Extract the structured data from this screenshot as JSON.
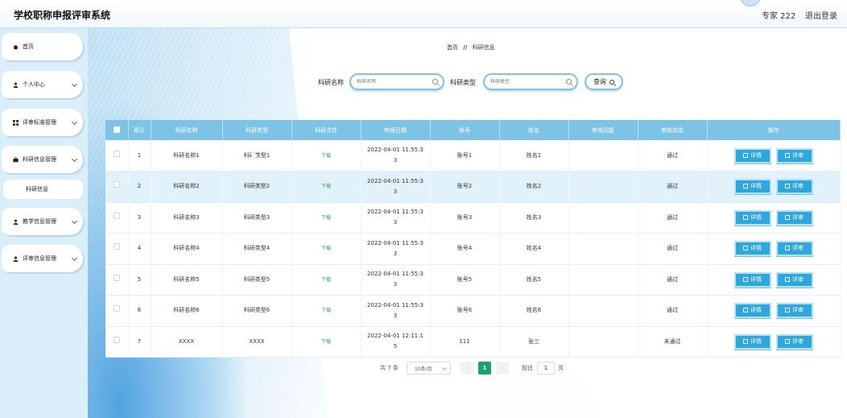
{
  "header": {
    "app_title": "学校职称申报评审系统",
    "user": "专家 222",
    "logout": "退出登录"
  },
  "sidebar": {
    "items": [
      {
        "label": "首页",
        "icon": "home-icon"
      },
      {
        "label": "个人中心",
        "icon": "person-icon"
      },
      {
        "label": "评审标准管理",
        "icon": "grid-icon"
      },
      {
        "label": "科研信息管理",
        "icon": "briefcase-icon"
      },
      {
        "label": "科研信息",
        "icon": ""
      },
      {
        "label": "教学信息管理",
        "icon": "person-icon"
      },
      {
        "label": "评审信息管理",
        "icon": "person-icon"
      }
    ]
  },
  "breadcrumb": {
    "home": "首页",
    "separator": "//",
    "current": "科研信息"
  },
  "search": {
    "name_label": "科研名称",
    "name_placeholder": "科研名称",
    "type_label": "科研类型",
    "type_placeholder": "科研类型",
    "query_button": "查询"
  },
  "table": {
    "headers": [
      "索引",
      "科研名称",
      "科研类型",
      "科研文件",
      "申报日期",
      "账号",
      "姓名",
      "审核回复",
      "审核状态",
      "操作"
    ],
    "download_label": "下载",
    "detail_label": "详情",
    "review_label": "评审",
    "rows": [
      {
        "index": "1",
        "name": "科研名称1",
        "type": "科研类型1",
        "date_line1": "2022-04-01 11:55:3",
        "date_line2": "3",
        "account": "账号1",
        "person": "姓名1",
        "reply": "",
        "status": "通过"
      },
      {
        "index": "2",
        "name": "科研名称2",
        "type": "科研类型2",
        "date_line1": "2022-04-01 11:55:3",
        "date_line2": "3",
        "account": "账号2",
        "person": "姓名2",
        "reply": "",
        "status": "通过"
      },
      {
        "index": "3",
        "name": "科研名称3",
        "type": "科研类型3",
        "date_line1": "2022-04-01 11:55:3",
        "date_line2": "3",
        "account": "账号3",
        "person": "姓名3",
        "reply": "",
        "status": "通过"
      },
      {
        "index": "4",
        "name": "科研名称4",
        "type": "科研类型4",
        "date_line1": "2022-04-01 11:55:3",
        "date_line2": "3",
        "account": "账号4",
        "person": "姓名4",
        "reply": "",
        "status": "通过"
      },
      {
        "index": "5",
        "name": "科研名称5",
        "type": "科研类型5",
        "date_line1": "2022-04-01 11:55:3",
        "date_line2": "3",
        "account": "账号5",
        "person": "姓名5",
        "reply": "",
        "status": "通过"
      },
      {
        "index": "6",
        "name": "科研名称6",
        "type": "科研类型6",
        "date_line1": "2022-04-01 11:55:3",
        "date_line2": "3",
        "account": "账号6",
        "person": "姓名6",
        "reply": "",
        "status": "通过"
      },
      {
        "index": "7",
        "name": "XXXX",
        "type": "XXXX",
        "date_line1": "2022-04-01 12:11:1",
        "date_line2": "5",
        "account": "111",
        "person": "张三",
        "reply": "",
        "status": "未通过"
      }
    ]
  },
  "pagination": {
    "total": "共 7 条",
    "page_size": "10条/页",
    "prev": "‹",
    "current_page": "1",
    "next": "›",
    "goto_label": "前往",
    "goto_value": "1",
    "page_suffix": "页"
  },
  "colors": {
    "accent": "#2ea7dd",
    "header_bg": "#7cc3e6",
    "current_page": "#1aa36b",
    "download": "#2e9e5a"
  }
}
